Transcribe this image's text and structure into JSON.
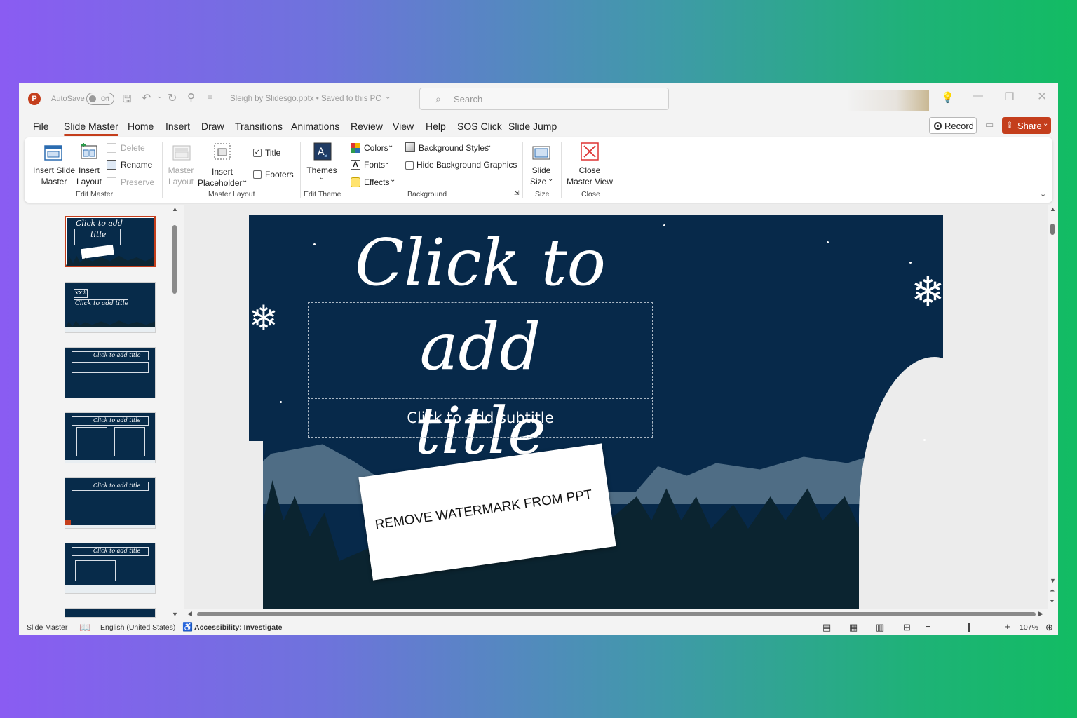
{
  "titlebar": {
    "autosave_label": "AutoSave",
    "autosave_state": "Off",
    "doc_title": "Sleigh by Slidesgo.pptx • Saved to this PC",
    "search_placeholder": "Search"
  },
  "menu": {
    "tabs": [
      "File",
      "Slide Master",
      "Home",
      "Insert",
      "Draw",
      "Transitions",
      "Animations",
      "Review",
      "View",
      "Help",
      "SOS Click",
      "Slide Jump"
    ],
    "active": "Slide Master",
    "record_label": "Record",
    "share_label": "Share"
  },
  "ribbon": {
    "insert_slide_master": "Insert Slide\nMaster",
    "insert_slide_master_1": "Insert Slide",
    "insert_slide_master_2": "Master",
    "insert_layout_1": "Insert",
    "insert_layout_2": "Layout",
    "delete": "Delete",
    "rename": "Rename",
    "preserve": "Preserve",
    "group_edit_master": "Edit Master",
    "master_layout_1": "Master",
    "master_layout_2": "Layout",
    "insert_placeholder_1": "Insert",
    "insert_placeholder_2": "Placeholder",
    "title_checkbox": "Title",
    "footers_checkbox": "Footers",
    "group_master_layout": "Master Layout",
    "themes": "Themes",
    "group_edit_theme": "Edit Theme",
    "colors": "Colors",
    "fonts": "Fonts",
    "effects": "Effects",
    "background_styles": "Background Styles",
    "hide_background_graphics": "Hide Background Graphics",
    "group_background": "Background",
    "slide_size_1": "Slide",
    "slide_size_2": "Size",
    "group_size": "Size",
    "close_master_view_1": "Close",
    "close_master_view_2": "Master View",
    "group_close": "Close"
  },
  "thumbnails": [
    {
      "title": "Click to add title",
      "selected": true
    },
    {
      "title": "Click to add title",
      "number": "xx%"
    },
    {
      "title": "Click to add title"
    },
    {
      "title": "Click to add title"
    },
    {
      "title": "Click to add title"
    },
    {
      "title": "Click to add title"
    },
    {
      "title": ""
    }
  ],
  "thumb_text": {
    "t1_line1": "Click to add",
    "t1_line2": "title",
    "t2_pct": "xx%",
    "t_title": "Click to add title"
  },
  "slide": {
    "title_line1": "Click to add",
    "title_line2": "title",
    "subtitle": "Click to add subtitle",
    "watermark": "REMOVE WATERMARK FROM PPT",
    "background_color": "#07294a"
  },
  "statusbar": {
    "view": "Slide Master",
    "language": "English (United States)",
    "accessibility": "Accessibility: Investigate",
    "zoom": "107%"
  },
  "colors": {
    "accent": "#c43e1c"
  }
}
